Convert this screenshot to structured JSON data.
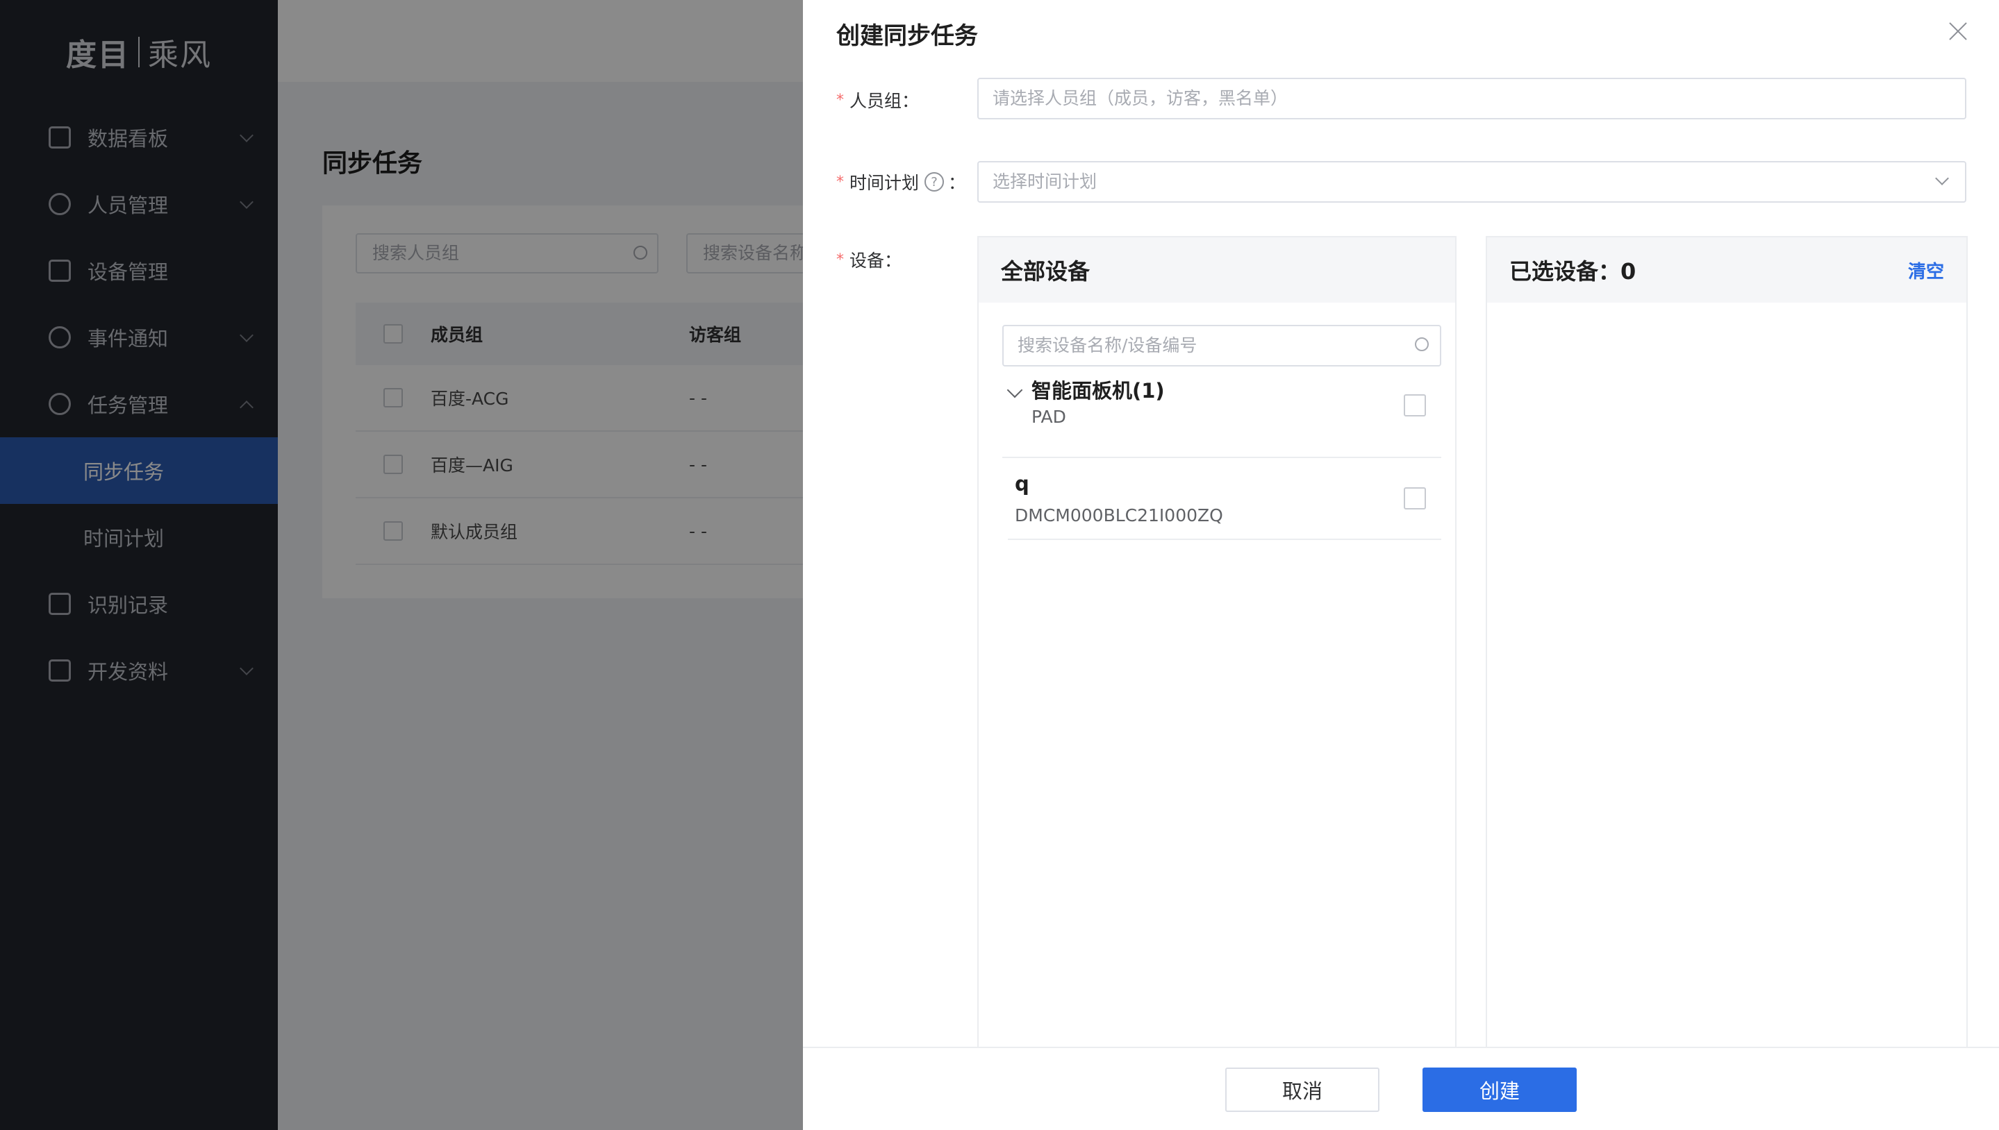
{
  "app": {
    "brand": "度目",
    "product": "乘风"
  },
  "sidebar": {
    "items": [
      {
        "label": "数据看板",
        "icon": "bar-chart-icon",
        "expandable": true
      },
      {
        "label": "人员管理",
        "icon": "user-icon",
        "expandable": true
      },
      {
        "label": "设备管理",
        "icon": "device-icon",
        "expandable": false
      },
      {
        "label": "事件通知",
        "icon": "bell-icon",
        "expandable": true
      },
      {
        "label": "任务管理",
        "icon": "task-icon",
        "expandable": true,
        "expanded": true
      },
      {
        "label": "识别记录",
        "icon": "calendar-icon",
        "expandable": false
      },
      {
        "label": "开发资料",
        "icon": "code-icon",
        "expandable": true
      }
    ],
    "sub_items": [
      {
        "label": "同步任务",
        "active": true
      },
      {
        "label": "时间计划",
        "active": false
      }
    ]
  },
  "background": {
    "page_title": "同步任务",
    "search_group_placeholder": "搜索人员组",
    "search_device_placeholder": "搜索设备名称",
    "columns": [
      "成员组",
      "访客组"
    ],
    "rows": [
      {
        "member_group": "百度-ACG",
        "visitor_group": "- -"
      },
      {
        "member_group": "百度—AIG",
        "visitor_group": "- -"
      },
      {
        "member_group": "默认成员组",
        "visitor_group": "- -"
      }
    ]
  },
  "drawer": {
    "title": "创建同步任务",
    "person_group": {
      "label": "人员组：",
      "placeholder": "请选择人员组（成员，访客，黑名单）"
    },
    "time_plan": {
      "label": "时间计划",
      "help": "?",
      "colon": "：",
      "placeholder": "选择时间计划"
    },
    "device": {
      "label": "设备："
    },
    "all_devices": {
      "title": "全部设备",
      "search_placeholder": "搜索设备名称/设备编号",
      "group": {
        "name": "智能面板机(1)",
        "code": "PAD"
      },
      "children": [
        {
          "name": "q",
          "code": "DMCM000BLC21I000ZQ"
        }
      ]
    },
    "selected_devices": {
      "title": "已选设备：0",
      "clear_label": "清空"
    },
    "footer": {
      "cancel_label": "取消",
      "create_label": "创建"
    }
  },
  "colors": {
    "primary": "#2b6de5",
    "sidebar_bg": "#22252d",
    "active_nav": "#2c5cb2",
    "required": "#f56c6c"
  }
}
